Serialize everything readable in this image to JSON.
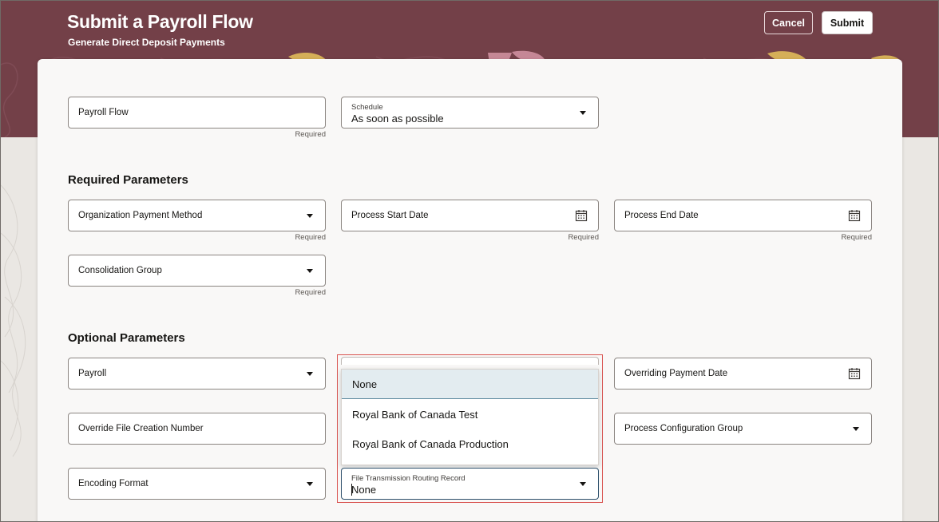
{
  "header": {
    "title": "Submit a Payroll Flow",
    "subtitle": "Generate Direct Deposit Payments",
    "cancel_label": "Cancel",
    "submit_label": "Submit",
    "background_color": "#734048"
  },
  "top_fields": {
    "payroll_flow": {
      "label": "Payroll Flow",
      "required": "Required"
    },
    "schedule": {
      "label": "Schedule",
      "value": "As soon as possible"
    }
  },
  "required_section": {
    "heading": "Required Parameters",
    "organization_payment_method": {
      "label": "Organization Payment Method",
      "required": "Required"
    },
    "process_start_date": {
      "label": "Process Start Date",
      "required": "Required"
    },
    "process_end_date": {
      "label": "Process End Date",
      "required": "Required"
    },
    "consolidation_group": {
      "label": "Consolidation Group",
      "required": "Required"
    }
  },
  "optional_section": {
    "heading": "Optional Parameters",
    "payroll": {
      "label": "Payroll"
    },
    "overriding_payment_date": {
      "label": "Overriding Payment Date"
    },
    "override_file_creation_number": {
      "label": "Override File Creation Number"
    },
    "process_configuration_group": {
      "label": "Process Configuration Group"
    },
    "encoding_format": {
      "label": "Encoding Format"
    },
    "file_transmission_routing_record": {
      "label": "File Transmission Routing Record",
      "value": "None"
    }
  },
  "dropdown": {
    "options": [
      {
        "label": "None",
        "selected": true
      },
      {
        "label": "Royal Bank of Canada Test",
        "selected": false
      },
      {
        "label": "Royal Bank of Canada Production",
        "selected": false
      }
    ],
    "highlight_color": "#d9534f"
  },
  "icons": {
    "dropdown": "chevron-down-icon",
    "date": "calendar-icon"
  }
}
